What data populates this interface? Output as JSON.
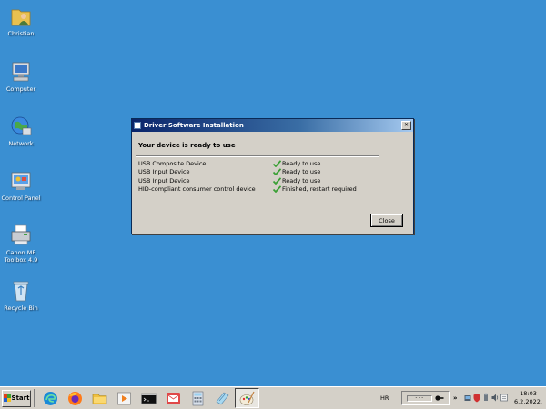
{
  "desktop": {
    "icons": [
      {
        "label": "Christian",
        "icon": "user-folder-icon"
      },
      {
        "label": "Computer",
        "icon": "computer-icon"
      },
      {
        "label": "Network",
        "icon": "network-icon"
      },
      {
        "label": "Control Panel",
        "icon": "control-panel-icon"
      },
      {
        "label": "Canon MF Toolbox 4.9",
        "icon": "printer-icon"
      },
      {
        "label": "Recycle Bin",
        "icon": "recycle-bin-icon"
      }
    ],
    "background": "#3a8fd2"
  },
  "dialog": {
    "title": "Driver Software Installation",
    "close_glyph": "✕",
    "heading": "Your device is ready to use",
    "devices": [
      {
        "name": "USB Composite Device",
        "status": "Ready to use"
      },
      {
        "name": "USB Input Device",
        "status": "Ready to use"
      },
      {
        "name": "USB Input Device",
        "status": "Ready to use"
      },
      {
        "name": "HID-compliant consumer control device",
        "status": "Finished, restart required"
      }
    ],
    "close_button": "Close",
    "check_color": "#3aa035"
  },
  "taskbar": {
    "start_label": "Start",
    "apps": [
      {
        "icon": "edge-icon"
      },
      {
        "icon": "firefox-icon"
      },
      {
        "icon": "file-explorer-icon"
      },
      {
        "icon": "media-player-icon"
      },
      {
        "icon": "command-prompt-icon"
      },
      {
        "icon": "mail-icon"
      },
      {
        "icon": "calculator-icon"
      },
      {
        "icon": "notepad-icon"
      },
      {
        "icon": "paint-icon",
        "active": true
      }
    ],
    "language": "HR",
    "tray": {
      "chevron": "»",
      "icons": [
        "network-tray-icon",
        "security-tray-icon",
        "usb-tray-icon",
        "volume-icon",
        "notification-icon"
      ]
    },
    "clock": {
      "time": "18:03",
      "date": "6.2.2022."
    }
  }
}
